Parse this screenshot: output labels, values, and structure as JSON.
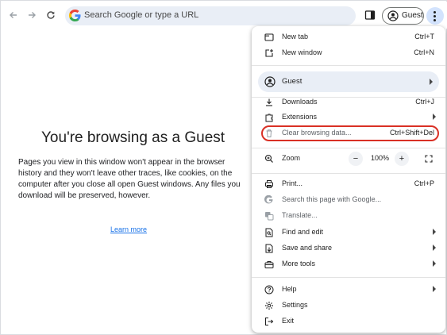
{
  "toolbar": {
    "omnibox_placeholder": "Search Google or type a URL",
    "profile_label": "Guest"
  },
  "page": {
    "title": "You're browsing as a Guest",
    "body": "Pages you view in this window won't appear in the browser history and they won't leave other traces, like cookies, on the computer after you close all open Guest windows. Any files you download will be preserved, however.",
    "learn_more": "Learn more"
  },
  "menu": {
    "new_tab": {
      "label": "New tab",
      "shortcut": "Ctrl+T"
    },
    "new_window": {
      "label": "New window",
      "shortcut": "Ctrl+N"
    },
    "guest": {
      "label": "Guest"
    },
    "downloads": {
      "label": "Downloads",
      "shortcut": "Ctrl+J"
    },
    "extensions": {
      "label": "Extensions"
    },
    "clear_browsing_data": {
      "label": "Clear browsing data...",
      "shortcut": "Ctrl+Shift+Del"
    },
    "zoom": {
      "label": "Zoom",
      "minus": "−",
      "value": "100%",
      "plus": "+"
    },
    "print": {
      "label": "Print...",
      "shortcut": "Ctrl+P"
    },
    "search_page": {
      "label": "Search this page with Google..."
    },
    "translate": {
      "label": "Translate..."
    },
    "find_edit": {
      "label": "Find and edit"
    },
    "save_share": {
      "label": "Save and share"
    },
    "more_tools": {
      "label": "More tools"
    },
    "help": {
      "label": "Help"
    },
    "settings": {
      "label": "Settings"
    },
    "exit": {
      "label": "Exit"
    }
  },
  "colors": {
    "highlight_ring": "#d93025",
    "link": "#1a73e8",
    "omnibox_bg": "#e9eef6",
    "menu_button_active": "#d3e3fd"
  }
}
